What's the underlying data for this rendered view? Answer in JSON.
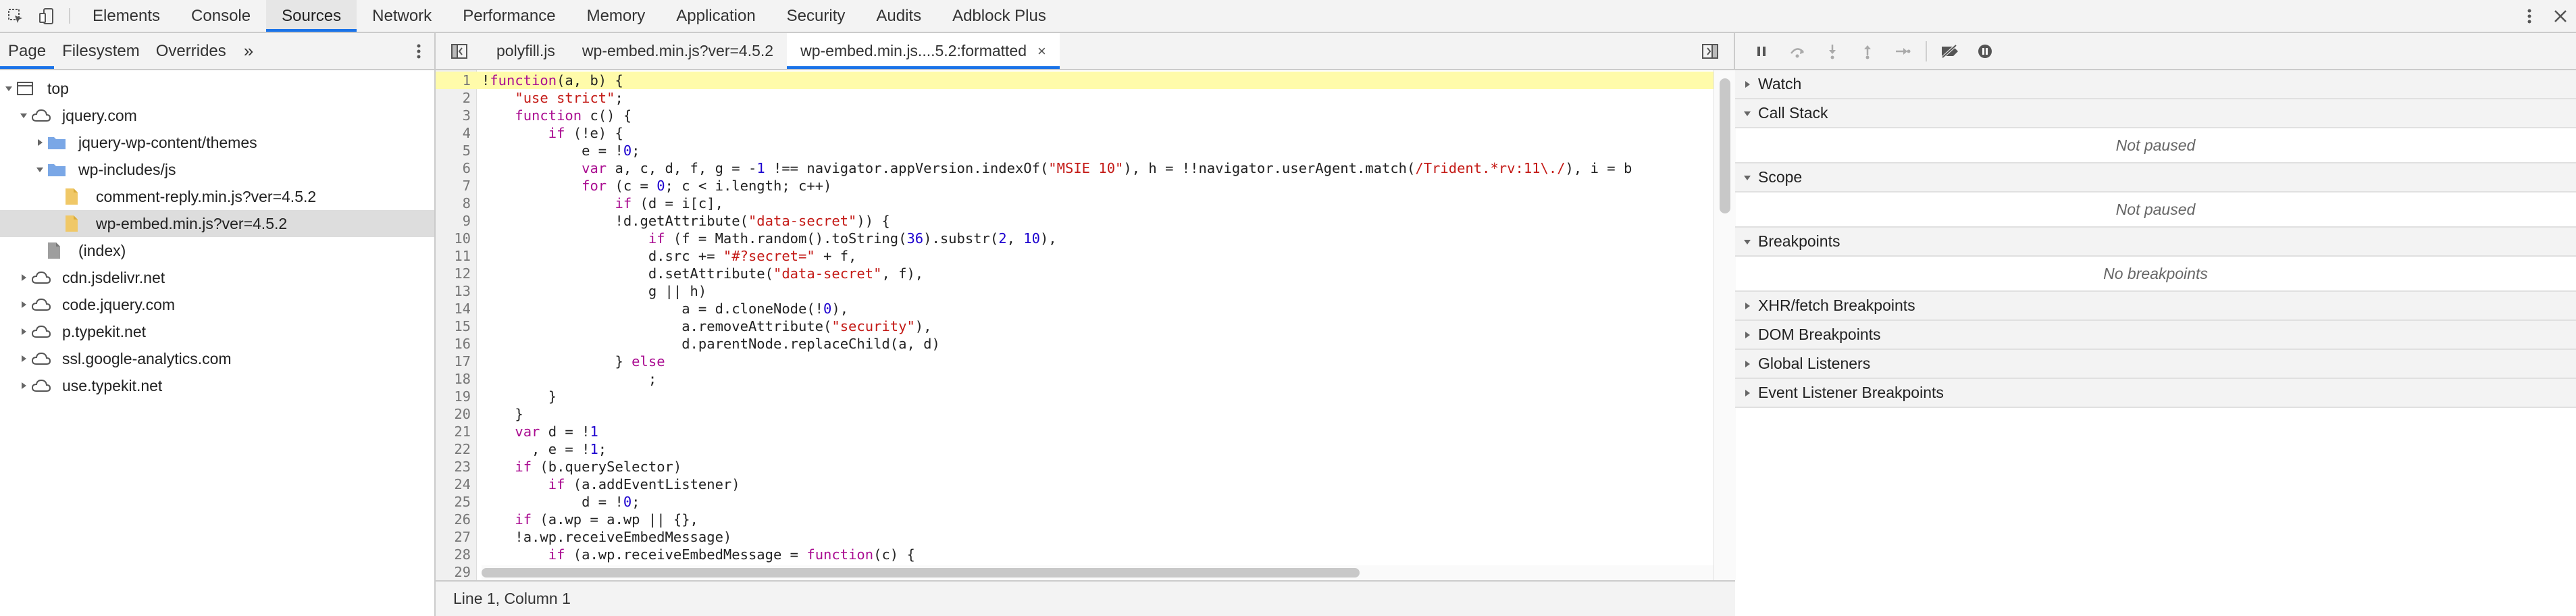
{
  "mainbar": {
    "tabs": [
      "Elements",
      "Console",
      "Sources",
      "Network",
      "Performance",
      "Memory",
      "Application",
      "Security",
      "Audits",
      "Adblock Plus"
    ],
    "active_tab": "Sources"
  },
  "navigator": {
    "tabs": [
      "Page",
      "Filesystem",
      "Overrides"
    ],
    "more_label": "»",
    "tree": [
      {
        "label": "top",
        "icon": "frame-icon",
        "arrow": "down",
        "indent": 0
      },
      {
        "label": "jquery.com",
        "icon": "cloud-icon",
        "arrow": "down",
        "indent": 1
      },
      {
        "label": "jquery-wp-content/themes",
        "icon": "folder-icon",
        "arrow": "right",
        "indent": 2
      },
      {
        "label": "wp-includes/js",
        "icon": "folder-icon",
        "arrow": "down",
        "indent": 2
      },
      {
        "label": "comment-reply.min.js?ver=4.5.2",
        "icon": "js-file-icon",
        "arrow": "none",
        "indent": 3
      },
      {
        "label": "wp-embed.min.js?ver=4.5.2",
        "icon": "js-file-icon",
        "arrow": "none",
        "indent": 3,
        "selected": true
      },
      {
        "label": "(index)",
        "icon": "file-icon",
        "arrow": "none",
        "indent": 2
      },
      {
        "label": "cdn.jsdelivr.net",
        "icon": "cloud-icon",
        "arrow": "right",
        "indent": 1
      },
      {
        "label": "code.jquery.com",
        "icon": "cloud-icon",
        "arrow": "right",
        "indent": 1
      },
      {
        "label": "p.typekit.net",
        "icon": "cloud-icon",
        "arrow": "right",
        "indent": 1
      },
      {
        "label": "ssl.google-analytics.com",
        "icon": "cloud-icon",
        "arrow": "right",
        "indent": 1
      },
      {
        "label": "use.typekit.net",
        "icon": "cloud-icon",
        "arrow": "right",
        "indent": 1
      }
    ]
  },
  "editor": {
    "tabs": [
      {
        "label": "polyfill.js",
        "active": false
      },
      {
        "label": "wp-embed.min.js?ver=4.5.2",
        "active": false
      },
      {
        "label": "wp-embed.min.js....5.2:formatted",
        "active": true,
        "close": "×"
      }
    ],
    "highlight_line": 1,
    "lines": [
      "!function(a, b) {",
      "    \"use strict\";",
      "    function c() {",
      "        if (!e) {",
      "            e = !0;",
      "            var a, c, d, f, g = -1 !== navigator.appVersion.indexOf(\"MSIE 10\"), h = !!navigator.userAgent.match(/Trident.*rv:11\\./), i = b",
      "            for (c = 0; c < i.length; c++)",
      "                if (d = i[c],",
      "                !d.getAttribute(\"data-secret\")) {",
      "                    if (f = Math.random().toString(36).substr(2, 10),",
      "                    d.src += \"#?secret=\" + f,",
      "                    d.setAttribute(\"data-secret\", f),",
      "                    g || h)",
      "                        a = d.cloneNode(!0),",
      "                        a.removeAttribute(\"security\"),",
      "                        d.parentNode.replaceChild(a, d)",
      "                } else",
      "                    ;",
      "        }",
      "    }",
      "    var d = !1",
      "      , e = !1;",
      "    if (b.querySelector)",
      "        if (a.addEventListener)",
      "            d = !0;",
      "    if (a.wp = a.wp || {},",
      "    !a.wp.receiveEmbedMessage)",
      "        if (a.wp.receiveEmbedMessage = function(c) {",
      ""
    ],
    "status": "Line 1, Column 1"
  },
  "debugger": {
    "panes": [
      {
        "title": "Watch",
        "expanded": false
      },
      {
        "title": "Call Stack",
        "expanded": true,
        "body": "Not paused"
      },
      {
        "title": "Scope",
        "expanded": true,
        "body": "Not paused"
      },
      {
        "title": "Breakpoints",
        "expanded": true,
        "body": "No breakpoints"
      },
      {
        "title": "XHR/fetch Breakpoints",
        "expanded": false
      },
      {
        "title": "DOM Breakpoints",
        "expanded": false
      },
      {
        "title": "Global Listeners",
        "expanded": false
      },
      {
        "title": "Event Listener Breakpoints",
        "expanded": false
      }
    ]
  },
  "colors": {
    "accent": "#1a73e8",
    "folder": "#7aa7e6",
    "jsfile": "#f0c867",
    "highlight": "#fffbaa"
  }
}
